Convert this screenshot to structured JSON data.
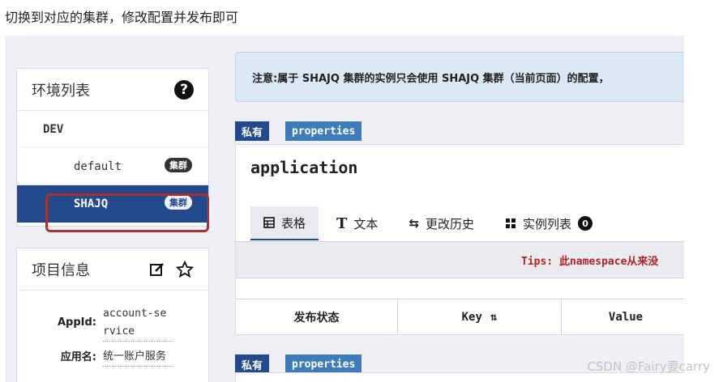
{
  "caption": "切换到对应的集群，修改配置并发布即可",
  "env_panel": {
    "title": "环境列表",
    "help_icon": "question-circle-icon",
    "items": [
      {
        "label": "DEV",
        "level": "env"
      },
      {
        "label": "default",
        "level": "cluster",
        "badge": "集群"
      },
      {
        "label": "SHAJQ",
        "level": "cluster",
        "badge": "集群",
        "active": true
      }
    ]
  },
  "project_panel": {
    "title": "项目信息",
    "edit_icon": "edit-icon",
    "star_icon": "star-icon",
    "fields": [
      {
        "label": "AppId:",
        "value": "account-service"
      },
      {
        "label": "应用名:",
        "value": "统一账户服务"
      }
    ]
  },
  "notice": "注意:属于 SHAJQ 集群的实例只会使用 SHAJQ 集群（当前页面）的配置，",
  "namespace": {
    "tags": {
      "private": "私有",
      "format": "properties"
    },
    "name": "application",
    "tabs": [
      {
        "label": "表格",
        "icon": "table-icon",
        "active": true
      },
      {
        "label": "文本",
        "icon": "text-icon"
      },
      {
        "label": "更改历史",
        "icon": "history-icon"
      },
      {
        "label": "实例列表",
        "icon": "instances-icon",
        "count": "0"
      }
    ],
    "tips": "Tips: 此namespace从来没",
    "columns": [
      "发布状态",
      "Key",
      "Value"
    ]
  },
  "namespace2": {
    "tags": {
      "private": "私有",
      "format": "properties"
    }
  },
  "watermark": "CSDN @Fairy要carry",
  "colors": {
    "primary": "#244a8e",
    "format_tag": "#3d7cb8",
    "highlight": "#a83232",
    "tips": "#b22222"
  }
}
